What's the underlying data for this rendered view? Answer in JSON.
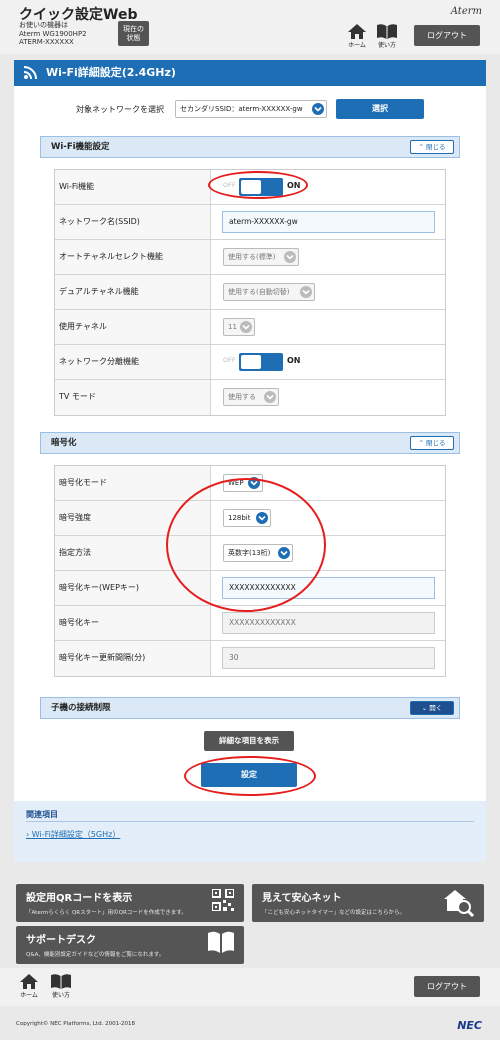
{
  "header": {
    "title": "クイック設定Web",
    "device_line1": "お使いの機器は",
    "device_line2": "Aterm WG1900HP2",
    "device_line3": "ATERM-XXXXXX",
    "status_line1": "現在の",
    "status_line2": "状態",
    "home_label": "ホーム",
    "manual_label": "使い方",
    "logout_label": "ログアウト",
    "brand": "Aterm"
  },
  "page": {
    "title": "Wi-Fi詳細設定(2.4GHz)",
    "network_label": "対象ネットワークを選択",
    "network_value": "セカンダリSSID：aterm-XXXXXX-gw",
    "select_button": "選択"
  },
  "wifi_section": {
    "title": "Wi-Fi機能設定",
    "collapse_label": "閉じる",
    "rows": [
      {
        "label": "Wi-Fi機能",
        "off": "OFF",
        "on": "ON"
      },
      {
        "label": "ネットワーク名(SSID)",
        "value": "aterm-XXXXXX-gw"
      },
      {
        "label": "オートチャネルセレクト機能",
        "value": "使用する(標準)"
      },
      {
        "label": "デュアルチャネル機能",
        "value": "使用する(自動切替)"
      },
      {
        "label": "使用チャネル",
        "value": "11"
      },
      {
        "label": "ネットワーク分離機能",
        "off": "OFF",
        "on": "ON"
      },
      {
        "label": "TV モード",
        "value": "使用する"
      }
    ]
  },
  "encrypt_section": {
    "title": "暗号化",
    "collapse_label": "閉じる",
    "rows": [
      {
        "label": "暗号化モード",
        "value": "WEP"
      },
      {
        "label": "暗号強度",
        "value": "128bit"
      },
      {
        "label": "指定方法",
        "value": "英数字(13桁)"
      },
      {
        "label": "暗号化キー(WEPキー)",
        "value": "XXXXXXXXXXXXX"
      },
      {
        "label": "暗号化キー",
        "value": "XXXXXXXXXXXXX"
      },
      {
        "label": "暗号化キー更新間隔(分)",
        "value": "30"
      }
    ]
  },
  "child_section": {
    "title": "子機の接続制限",
    "expand_label": "開く"
  },
  "actions": {
    "detail_button": "詳細な項目を表示",
    "submit_button": "設定"
  },
  "related": {
    "title": "関連項目",
    "link": "Wi-Fi詳細設定（5GHz）"
  },
  "promos": [
    {
      "title": "設定用QRコードを表示",
      "desc": "「Atermらくらく QRスタート」用のQRコードを作成できます。"
    },
    {
      "title": "見えて安心ネット",
      "desc": "「こども安心ネットタイマー」などの設定はこちらから。"
    },
    {
      "title": "サポートデスク",
      "desc": "Q&A、機能別設定ガイドなどの情報をご覧になれます。"
    }
  ],
  "footer": {
    "home_label": "ホーム",
    "manual_label": "使い方",
    "logout_label": "ログアウト",
    "copyright": "Copyright© NEC Platforms, Ltd. 2001-2018",
    "nec": "NEC"
  },
  "colors": {
    "accent": "#1e6eb5",
    "highlight": "#e51d1d"
  }
}
